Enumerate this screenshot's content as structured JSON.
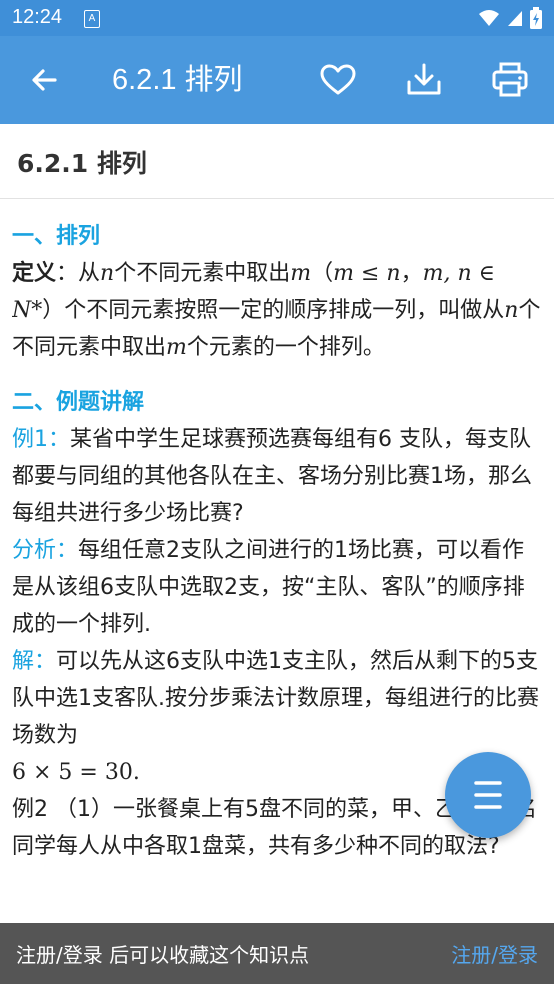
{
  "status_bar": {
    "time": "12:24",
    "notification_glyph": "A"
  },
  "app_bar": {
    "title": "6.2.1 排列",
    "back_icon": "arrow-left",
    "favorite_icon": "heart-outline",
    "download_icon": "download",
    "print_icon": "printer"
  },
  "page": {
    "title": "6.2.1 排列"
  },
  "content": {
    "section1_heading": "一、排列",
    "definition": {
      "label": "定义",
      "colon": "：",
      "t1": "从",
      "m1": "n",
      "t2": "个不同元素中取出",
      "m2": "m",
      "t3": "（",
      "m3": "m ≤ n",
      "t4": "，",
      "m4": "m, n ∈ N*",
      "t5": "）个不同元素按照一定的顺序排成一列，叫做从",
      "m5": "n",
      "t6": "个不同元素中取出",
      "m6": "m",
      "t7": "个元素的一个排列。"
    },
    "section2_heading": "二、例题讲解",
    "example1": {
      "label": "例1：",
      "text": "某省中学生足球赛预选赛每组有6 支队，每支队都要与同组的其他各队在主、客场分别比赛1场，那么每组共进行多少场比赛?"
    },
    "analysis": {
      "label": "分析：",
      "text": "每组任意2支队之间进行的1场比赛，可以看作是从该组6支队中选取2支，按“主队、客队”的顺序排成的一个排列."
    },
    "solution": {
      "label": "解：",
      "text": "可以先从这6支队中选1支主队，然后从剩下的5支队中选1支客队.按分步乘法计数原理，每组进行的比赛场数为",
      "formula": "6 × 5 = 30."
    },
    "example2": {
      "text": "例2 （1）一张餐桌上有5盘不同的菜，甲、乙、丙3名同学每人从中各取1盘菜，共有多少种不同的取法?"
    }
  },
  "fab": {
    "icon": "menu-list"
  },
  "bottom_bar": {
    "message": "注册/登录 后可以收藏这个知识点",
    "action": "注册/登录"
  },
  "colors": {
    "accent": "#4a98dd",
    "heading": "#1aa3e0",
    "bottom_bar": "#555555",
    "link": "#55a7ee"
  }
}
